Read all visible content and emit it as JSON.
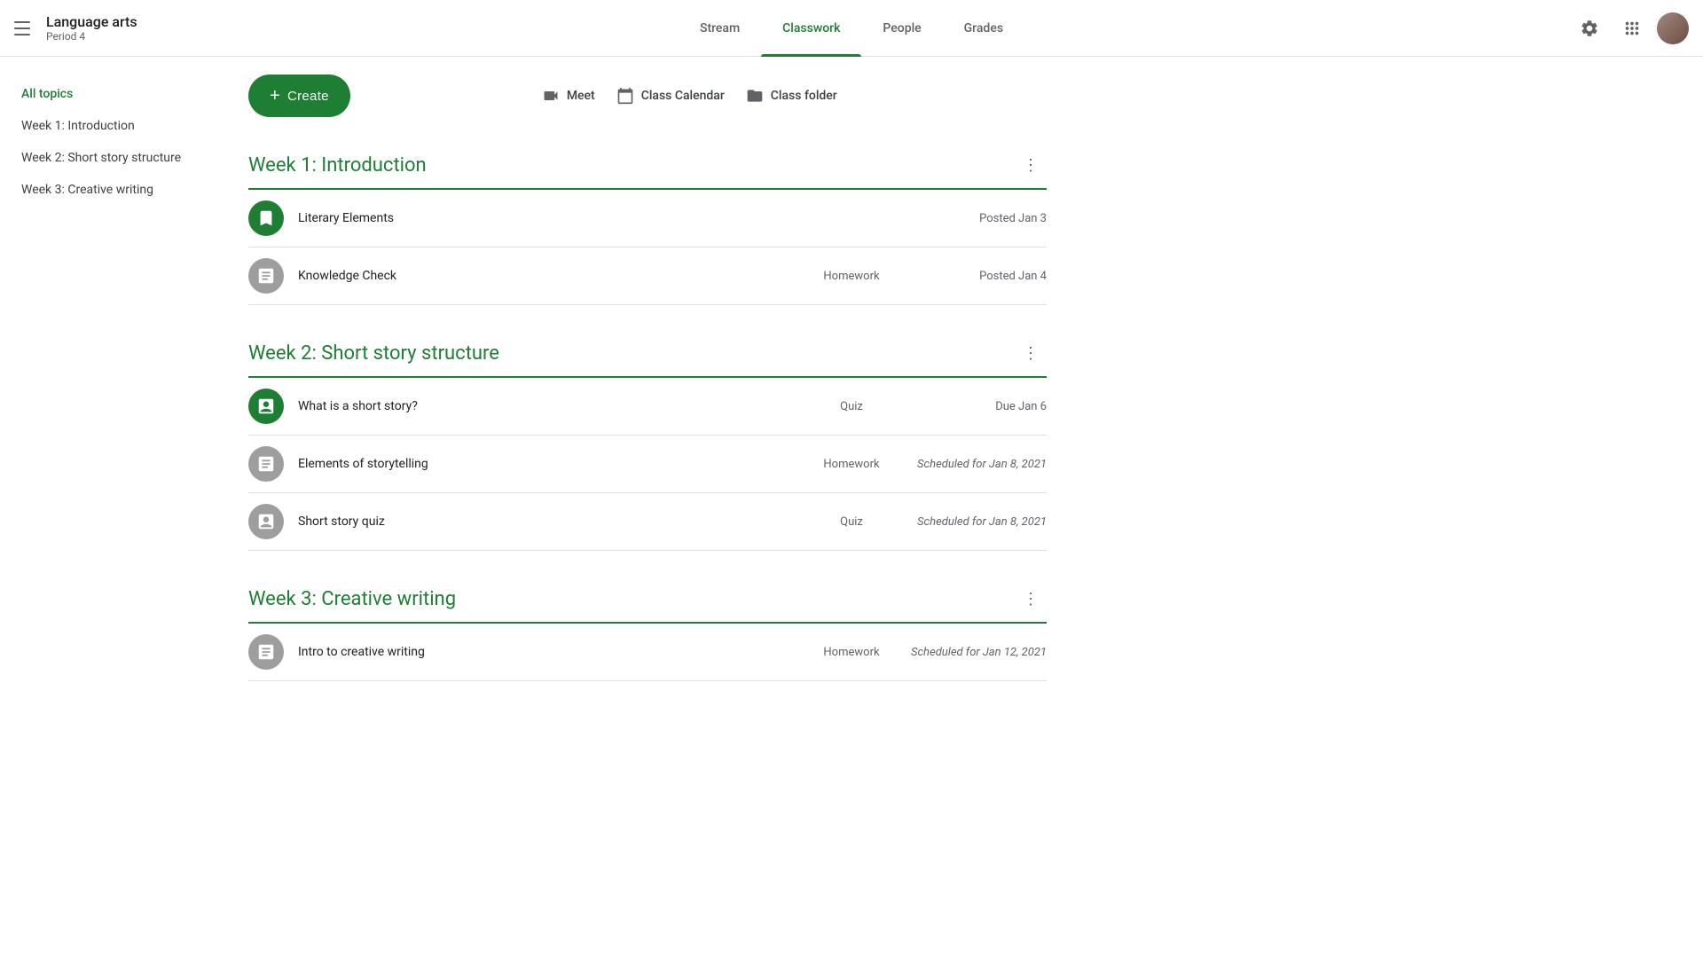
{
  "header": {
    "menu_label": "menu",
    "app_title": "Language arts",
    "app_subtitle": "Period 4",
    "tabs": [
      {
        "id": "stream",
        "label": "Stream",
        "active": false
      },
      {
        "id": "classwork",
        "label": "Classwork",
        "active": true
      },
      {
        "id": "people",
        "label": "People",
        "active": false
      },
      {
        "id": "grades",
        "label": "Grades",
        "active": false
      }
    ],
    "settings_label": "Settings",
    "apps_label": "Google apps",
    "account_label": "Account"
  },
  "toolbar": {
    "create_label": "Create",
    "meet_label": "Meet",
    "calendar_label": "Class Calendar",
    "folder_label": "Class folder"
  },
  "sidebar": {
    "items": [
      {
        "id": "all-topics",
        "label": "All topics",
        "active": true
      },
      {
        "id": "week1",
        "label": "Week 1: Introduction",
        "active": false
      },
      {
        "id": "week2",
        "label": "Week 2: Short story structure",
        "active": false
      },
      {
        "id": "week3",
        "label": "Week 3: Creative writing",
        "active": false
      }
    ]
  },
  "weeks": [
    {
      "id": "week1",
      "title": "Week 1: Introduction",
      "assignments": [
        {
          "id": "literary-elements",
          "name": "Literary Elements",
          "type": "",
          "date": "Posted Jan 3",
          "icon_type": "green",
          "icon": "bookmark",
          "scheduled": false
        },
        {
          "id": "knowledge-check",
          "name": "Knowledge Check",
          "type": "Homework",
          "date": "Posted Jan 4",
          "icon_type": "gray",
          "icon": "assignment",
          "scheduled": false
        }
      ]
    },
    {
      "id": "week2",
      "title": "Week 2: Short story structure",
      "assignments": [
        {
          "id": "what-is-short-story",
          "name": "What is a short story?",
          "type": "Quiz",
          "date": "Due Jan 6",
          "icon_type": "green",
          "icon": "quiz",
          "scheduled": false
        },
        {
          "id": "elements-of-storytelling",
          "name": "Elements of storytelling",
          "type": "Homework",
          "date": "Scheduled for Jan 8, 2021",
          "icon_type": "gray",
          "icon": "assignment",
          "scheduled": true
        },
        {
          "id": "short-story-quiz",
          "name": "Short story quiz",
          "type": "Quiz",
          "date": "Scheduled for Jan 8, 2021",
          "icon_type": "gray",
          "icon": "quiz",
          "scheduled": true
        }
      ]
    },
    {
      "id": "week3",
      "title": "Week 3: Creative writing",
      "assignments": [
        {
          "id": "intro-creative-writing",
          "name": "Intro to creative writing",
          "type": "Homework",
          "date": "Scheduled for Jan 12, 2021",
          "icon_type": "gray",
          "icon": "assignment",
          "scheduled": true
        }
      ]
    }
  ]
}
